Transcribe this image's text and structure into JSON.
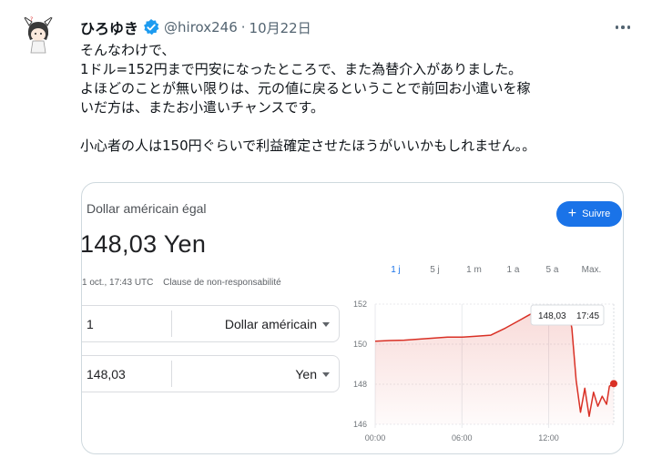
{
  "tweet": {
    "author_name": "ひろゆき",
    "handle": "@hirox246",
    "separator": "·",
    "date": "10月22日",
    "lines": [
      "そんなわけで、",
      "1ドル=152円まで円安になったところで、また為替介入がありました。",
      "よほどのことが無い限りは、元の値に戻るということで前回お小遣いを稼",
      "いだ方は、またお小遣いチャンスです。",
      "",
      "小心者の人は150円ぐらいで利益確定させたほうがいいかもしれません。。"
    ]
  },
  "card": {
    "title": "Dollar américain égal",
    "value": "148,03 Yen",
    "timestamp": "1 oct., 17:43 UTC",
    "disclaimer": "Clause de non-responsabilité",
    "follow_label": "Suivre",
    "follow_color": "#1a73e8",
    "converter": {
      "from_amount": "1",
      "from_unit": "Dollar américain",
      "to_amount": "148,03",
      "to_unit": "Yen"
    },
    "ranges": [
      "1 j",
      "5 j",
      "1 m",
      "1 a",
      "5 a",
      "Max."
    ],
    "active_range": "1 j",
    "tooltip": {
      "value": "148,03",
      "time": "17:45"
    }
  },
  "chart_data": {
    "type": "area",
    "title": "",
    "xlabel": "",
    "ylabel": "",
    "x_ticks": [
      "00:00",
      "06:00",
      "12:00"
    ],
    "y_ticks": [
      146,
      148,
      150,
      152
    ],
    "ylim": [
      146,
      152
    ],
    "x_range_hours": [
      0,
      16.5
    ],
    "line_color": "#d93025",
    "series": [
      {
        "x": [
          0,
          1,
          2,
          3,
          4,
          5,
          6,
          7,
          8,
          9,
          10,
          10.5,
          11,
          11.5,
          12,
          12.5,
          13,
          13.3,
          13.6,
          13.9,
          14.2,
          14.5,
          14.8,
          15.1,
          15.4,
          15.7,
          16,
          16.2,
          16.5
        ],
        "y": [
          150.15,
          150.18,
          150.2,
          150.25,
          150.3,
          150.35,
          150.35,
          150.4,
          150.45,
          150.8,
          151.2,
          151.4,
          151.6,
          151.7,
          151.8,
          151.85,
          151.9,
          151.9,
          150.8,
          148.2,
          146.6,
          147.8,
          146.4,
          147.6,
          146.9,
          147.4,
          147.0,
          147.9,
          148.03
        ]
      }
    ]
  },
  "colors": {
    "verified": "#1d9bf0",
    "text_primary": "#0f1419",
    "text_secondary": "#536471",
    "border": "#cfd9de"
  }
}
